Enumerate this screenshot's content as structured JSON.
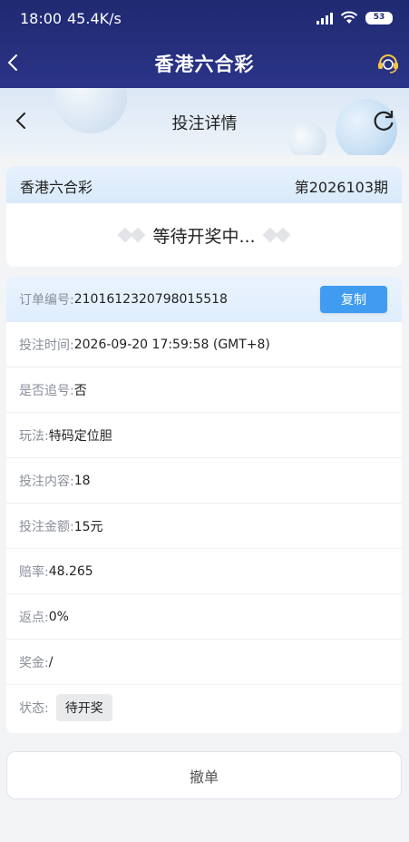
{
  "status_bar": {
    "time": "18:00",
    "speed": "45.4K/s",
    "battery": "53",
    "icons": [
      "signal-icon",
      "wifi-icon",
      "battery-icon"
    ]
  },
  "app_header": {
    "title": "香港六合彩",
    "icons": [
      "back-icon",
      "customer-service-icon"
    ]
  },
  "sub_header": {
    "title": "投注详情",
    "icons": [
      "back-icon",
      "refresh-icon"
    ]
  },
  "lottery": {
    "name": "香港六合彩",
    "period": "第2026103期",
    "status_text": "等待开奖中..."
  },
  "details": {
    "order_no": {
      "label": "订单编号:",
      "value": "2101612320798015518",
      "copy_label": "复制"
    },
    "bet_time": {
      "label": "投注时间:",
      "value": "2026-09-20 17:59:58 (GMT+8)"
    },
    "chase": {
      "label": "是否追号:",
      "value": "否"
    },
    "play": {
      "label": "玩法:",
      "value": "特码定位胆"
    },
    "content": {
      "label": "投注内容:",
      "value": "18"
    },
    "amount": {
      "label": "投注金额:",
      "value": "15元"
    },
    "odds": {
      "label": "赔率:",
      "value": "48.265"
    },
    "rebate": {
      "label": "返点:",
      "value": "0%"
    },
    "prize": {
      "label": "奖金:",
      "value": "/"
    },
    "status": {
      "label": "状态:",
      "value": "待开奖"
    }
  },
  "actions": {
    "cancel_label": "撤单"
  },
  "colors": {
    "navy": "#1f2a72",
    "accent_blue": "#3f9cf0",
    "background": "#f3f4f6"
  }
}
